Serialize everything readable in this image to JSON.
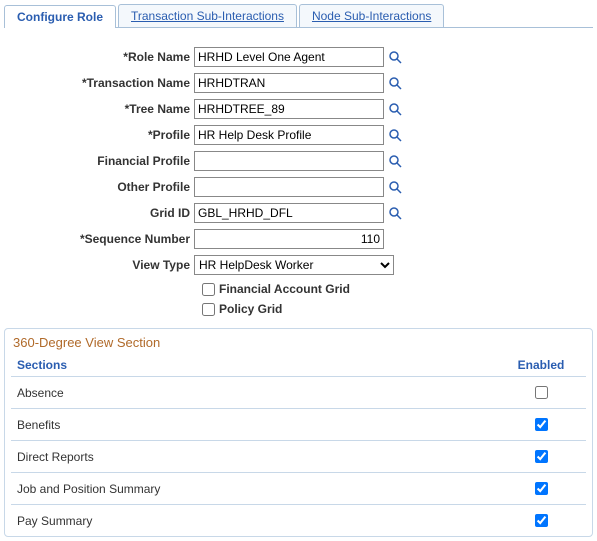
{
  "tabs": [
    {
      "label": "Configure Role",
      "active": true
    },
    {
      "label": "Transaction Sub-Interactions",
      "active": false
    },
    {
      "label": "Node Sub-Interactions",
      "active": false
    }
  ],
  "form": {
    "role_name": {
      "label": "*Role Name",
      "value": "HRHD Level One Agent"
    },
    "transaction_name": {
      "label": "*Transaction Name",
      "value": "HRHDTRAN"
    },
    "tree_name": {
      "label": "*Tree Name",
      "value": "HRHDTREE_89"
    },
    "profile": {
      "label": "*Profile",
      "value": "HR Help Desk Profile"
    },
    "financial_profile": {
      "label": "Financial Profile",
      "value": ""
    },
    "other_profile": {
      "label": "Other Profile",
      "value": ""
    },
    "grid_id": {
      "label": "Grid ID",
      "value": "GBL_HRHD_DFL"
    },
    "sequence_number": {
      "label": "*Sequence Number",
      "value": "110"
    },
    "view_type": {
      "label": "View Type",
      "value": "HR HelpDesk Worker"
    },
    "financial_account_grid": {
      "label": "Financial Account Grid",
      "checked": false
    },
    "policy_grid": {
      "label": "Policy Grid",
      "checked": false
    }
  },
  "section": {
    "title": "360-Degree View Section",
    "columns": {
      "sections": "Sections",
      "enabled": "Enabled"
    },
    "rows": [
      {
        "name": "Absence",
        "enabled": false
      },
      {
        "name": "Benefits",
        "enabled": true
      },
      {
        "name": "Direct Reports",
        "enabled": true
      },
      {
        "name": "Job and Position Summary",
        "enabled": true
      },
      {
        "name": "Pay Summary",
        "enabled": true
      }
    ]
  }
}
